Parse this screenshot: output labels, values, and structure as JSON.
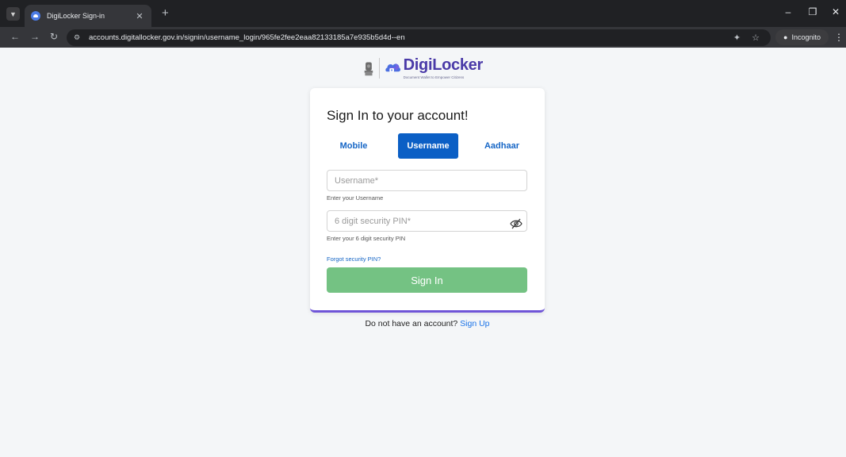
{
  "browser": {
    "tab_title": "DigiLocker Sign-in",
    "url": "accounts.digitallocker.gov.in/signin/username_login/965fe2fee2eaa82133185a7e935b5d4d--en",
    "incognito_label": "Incognito"
  },
  "logo": {
    "brand": "DigiLocker",
    "tagline": "Document Wallet to Empower Citizens"
  },
  "signin": {
    "title": "Sign In to your account!",
    "tabs": [
      {
        "label": "Mobile",
        "active": false
      },
      {
        "label": "Username",
        "active": true
      },
      {
        "label": "Aadhaar",
        "active": false
      }
    ],
    "username": {
      "placeholder": "Username*",
      "value": "",
      "helper": "Enter your Username"
    },
    "pin": {
      "placeholder": "6 digit security PIN*",
      "value": "",
      "helper": "Enter your 6 digit security PIN"
    },
    "forgot_label": "Forgot security PIN?",
    "submit_label": "Sign In"
  },
  "footer": {
    "prompt": "Do not have an account?",
    "signup_label": "Sign Up"
  },
  "colors": {
    "brand_purple": "#4a3aa8",
    "active_tab": "#0b5fc5",
    "link_blue": "#1666c6",
    "submit_green": "#74c283",
    "card_border": "#6f55d8"
  },
  "icons": {
    "tab_list": "chevron-down-icon",
    "close_tab": "close-icon",
    "new_tab": "plus-icon",
    "back": "arrow-left-icon",
    "forward": "arrow-right-icon",
    "reload": "reload-icon",
    "site_info": "tune-icon",
    "eye_off": "eye-off-icon",
    "bookmark": "star-icon",
    "incognito": "incognito-icon"
  }
}
